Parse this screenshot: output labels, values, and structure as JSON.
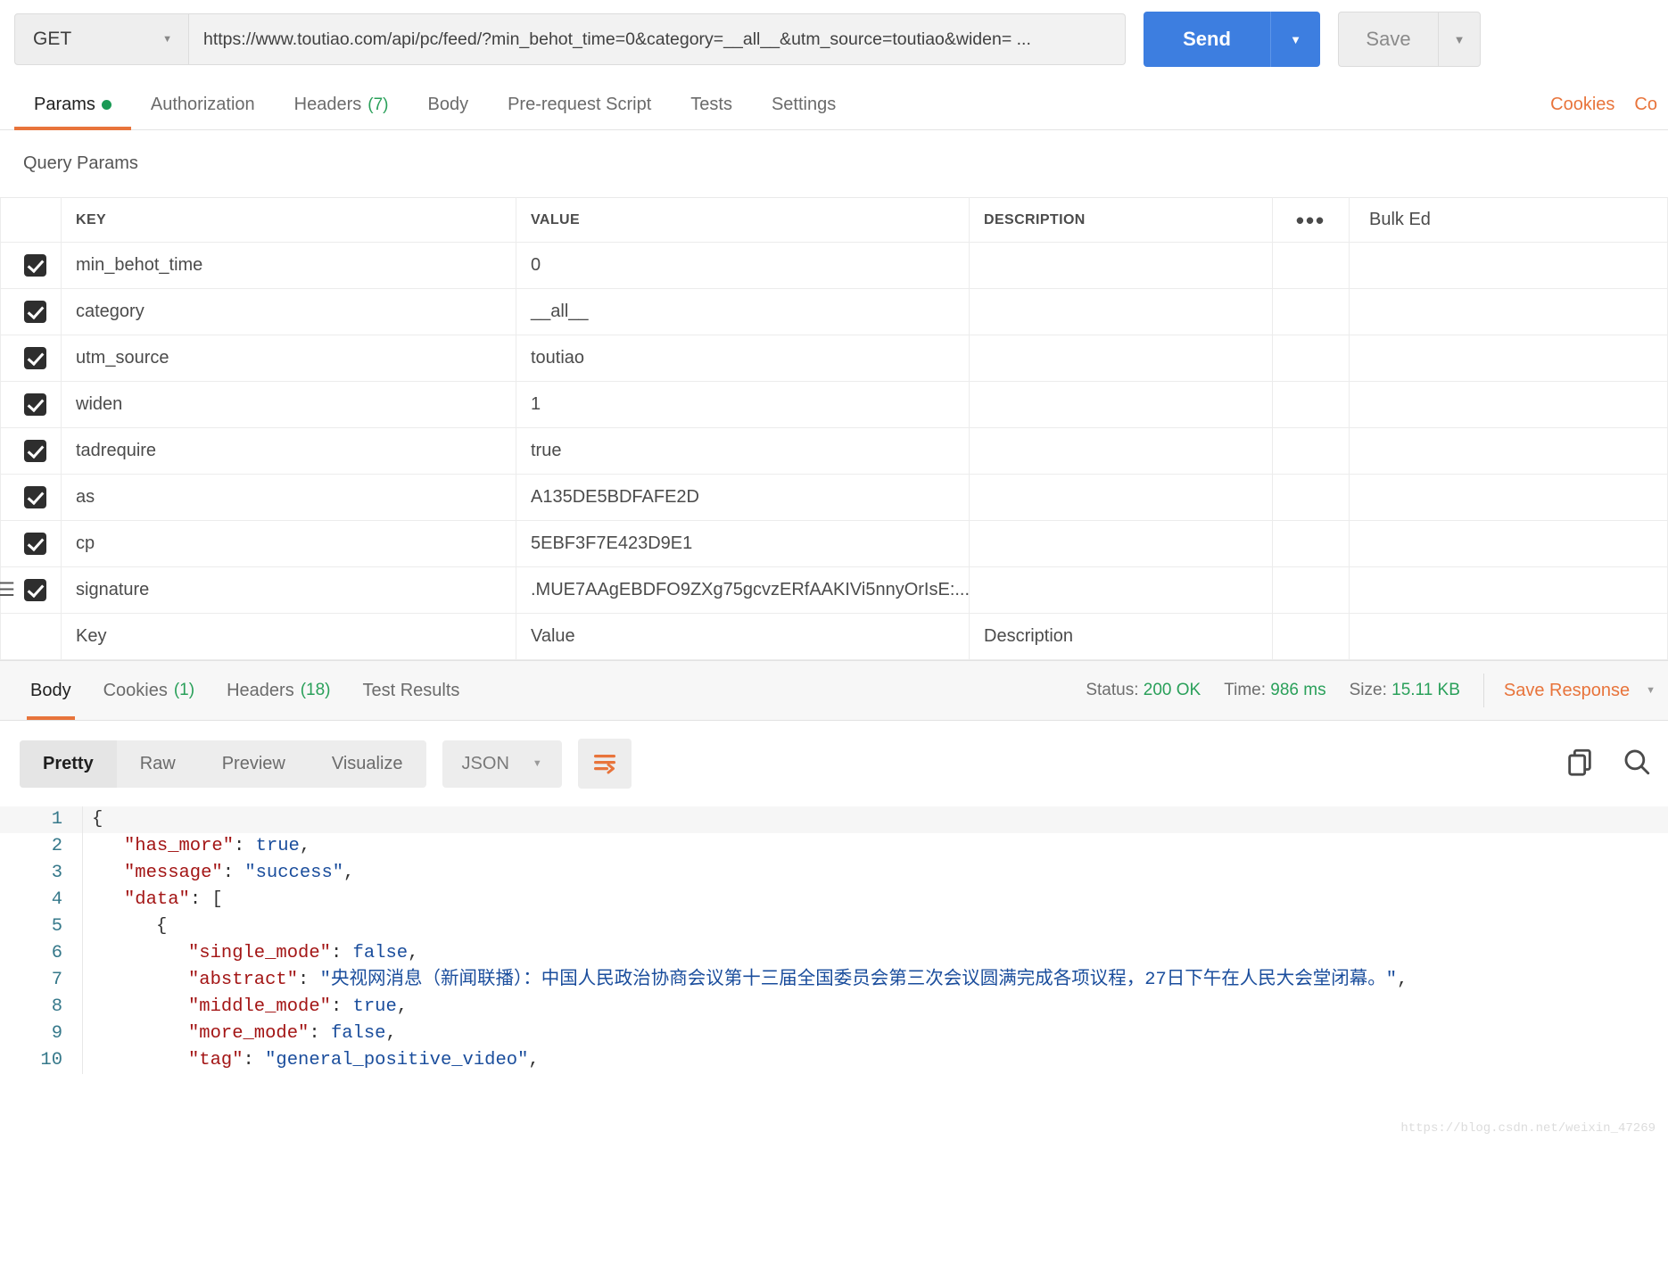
{
  "request": {
    "method": "GET",
    "method_caret": "▼",
    "url": "https://www.toutiao.com/api/pc/feed/?min_behot_time=0&category=__all__&utm_source=toutiao&widen= ...",
    "send_label": "Send",
    "send_caret": "▼",
    "save_label": "Save",
    "save_caret": "▼"
  },
  "request_tabs": {
    "items": [
      {
        "label": "Params",
        "badge": "",
        "dot": true,
        "active": true
      },
      {
        "label": "Authorization",
        "badge": "",
        "dot": false,
        "active": false
      },
      {
        "label": "Headers",
        "badge": "(7)",
        "dot": false,
        "active": false
      },
      {
        "label": "Body",
        "badge": "",
        "dot": false,
        "active": false
      },
      {
        "label": "Pre-request Script",
        "badge": "",
        "dot": false,
        "active": false
      },
      {
        "label": "Tests",
        "badge": "",
        "dot": false,
        "active": false
      },
      {
        "label": "Settings",
        "badge": "",
        "dot": false,
        "active": false
      }
    ],
    "right_links": [
      "Cookies",
      "Co"
    ]
  },
  "query_params": {
    "title": "Query Params",
    "columns": [
      "KEY",
      "VALUE",
      "DESCRIPTION"
    ],
    "actions_icon": "•••",
    "bulk_edit_label": "Bulk Ed",
    "rows": [
      {
        "checked": true,
        "drag": false,
        "key": "min_behot_time",
        "value": "0",
        "description": ""
      },
      {
        "checked": true,
        "drag": false,
        "key": "category",
        "value": "__all__",
        "description": ""
      },
      {
        "checked": true,
        "drag": false,
        "key": "utm_source",
        "value": "toutiao",
        "description": ""
      },
      {
        "checked": true,
        "drag": false,
        "key": "widen",
        "value": "1",
        "description": ""
      },
      {
        "checked": true,
        "drag": false,
        "key": "tadrequire",
        "value": "true",
        "description": ""
      },
      {
        "checked": true,
        "drag": false,
        "key": "as",
        "value": "A135DE5BDFAFE2D",
        "description": ""
      },
      {
        "checked": true,
        "drag": false,
        "key": "cp",
        "value": "5EBF3F7E423D9E1",
        "description": ""
      },
      {
        "checked": true,
        "drag": true,
        "key": "signature",
        "value": ".MUE7AAgEBDFO9ZXg75gcvzERfAAKIVi5nnyOrIsE:...",
        "description": ""
      }
    ],
    "empty_row": {
      "key_placeholder": "Key",
      "value_placeholder": "Value",
      "description_placeholder": "Description"
    }
  },
  "response": {
    "tabs": [
      {
        "label": "Body",
        "badge": "",
        "active": true
      },
      {
        "label": "Cookies",
        "badge": "(1)",
        "active": false
      },
      {
        "label": "Headers",
        "badge": "(18)",
        "active": false
      },
      {
        "label": "Test Results",
        "badge": "",
        "active": false
      }
    ],
    "status_label": "Status:",
    "status_value": "200 OK",
    "time_label": "Time:",
    "time_value": "986 ms",
    "size_label": "Size:",
    "size_value": "15.11 KB",
    "save_response_label": "Save Response",
    "save_response_caret": "▼"
  },
  "body_toolbar": {
    "view_modes": [
      "Pretty",
      "Raw",
      "Preview",
      "Visualize"
    ],
    "active_view_mode": "Pretty",
    "format": "JSON",
    "format_caret": "▼",
    "wrap_icon": "wrap-lines-icon",
    "copy_icon": "copy-icon",
    "search_icon": "search-icon"
  },
  "code": {
    "lines": [
      {
        "n": "1",
        "indent": 0,
        "tokens": [
          {
            "t": "{",
            "c": "p"
          }
        ]
      },
      {
        "n": "2",
        "indent": 1,
        "tokens": [
          {
            "t": "\"has_more\"",
            "c": "k"
          },
          {
            "t": ": ",
            "c": "p"
          },
          {
            "t": "true",
            "c": "b"
          },
          {
            "t": ",",
            "c": "p"
          }
        ]
      },
      {
        "n": "3",
        "indent": 1,
        "tokens": [
          {
            "t": "\"message\"",
            "c": "k"
          },
          {
            "t": ": ",
            "c": "p"
          },
          {
            "t": "\"success\"",
            "c": "s"
          },
          {
            "t": ",",
            "c": "p"
          }
        ]
      },
      {
        "n": "4",
        "indent": 1,
        "tokens": [
          {
            "t": "\"data\"",
            "c": "k"
          },
          {
            "t": ": [",
            "c": "p"
          }
        ]
      },
      {
        "n": "5",
        "indent": 2,
        "tokens": [
          {
            "t": "{",
            "c": "p"
          }
        ]
      },
      {
        "n": "6",
        "indent": 3,
        "tokens": [
          {
            "t": "\"single_mode\"",
            "c": "k"
          },
          {
            "t": ": ",
            "c": "p"
          },
          {
            "t": "false",
            "c": "b"
          },
          {
            "t": ",",
            "c": "p"
          }
        ]
      },
      {
        "n": "7",
        "indent": 3,
        "tokens": [
          {
            "t": "\"abstract\"",
            "c": "k"
          },
          {
            "t": ": ",
            "c": "p"
          },
          {
            "t": "\"央视网消息（新闻联播）：中国人民政治协商会议第十三届全国委员会第三次会议圆满完成各项议程，27日下午在人民大会堂闭幕。\"",
            "c": "s"
          },
          {
            "t": ",",
            "c": "p"
          }
        ]
      },
      {
        "n": "8",
        "indent": 3,
        "tokens": [
          {
            "t": "\"middle_mode\"",
            "c": "k"
          },
          {
            "t": ": ",
            "c": "p"
          },
          {
            "t": "true",
            "c": "b"
          },
          {
            "t": ",",
            "c": "p"
          }
        ]
      },
      {
        "n": "9",
        "indent": 3,
        "tokens": [
          {
            "t": "\"more_mode\"",
            "c": "k"
          },
          {
            "t": ": ",
            "c": "p"
          },
          {
            "t": "false",
            "c": "b"
          },
          {
            "t": ",",
            "c": "p"
          }
        ]
      },
      {
        "n": "10",
        "indent": 3,
        "tokens": [
          {
            "t": "\"tag\"",
            "c": "k"
          },
          {
            "t": ": ",
            "c": "p"
          },
          {
            "t": "\"general_positive_video\"",
            "c": "s"
          },
          {
            "t": ",",
            "c": "p"
          }
        ]
      }
    ]
  },
  "watermark": "https://blog.csdn.net/weixin_47269"
}
